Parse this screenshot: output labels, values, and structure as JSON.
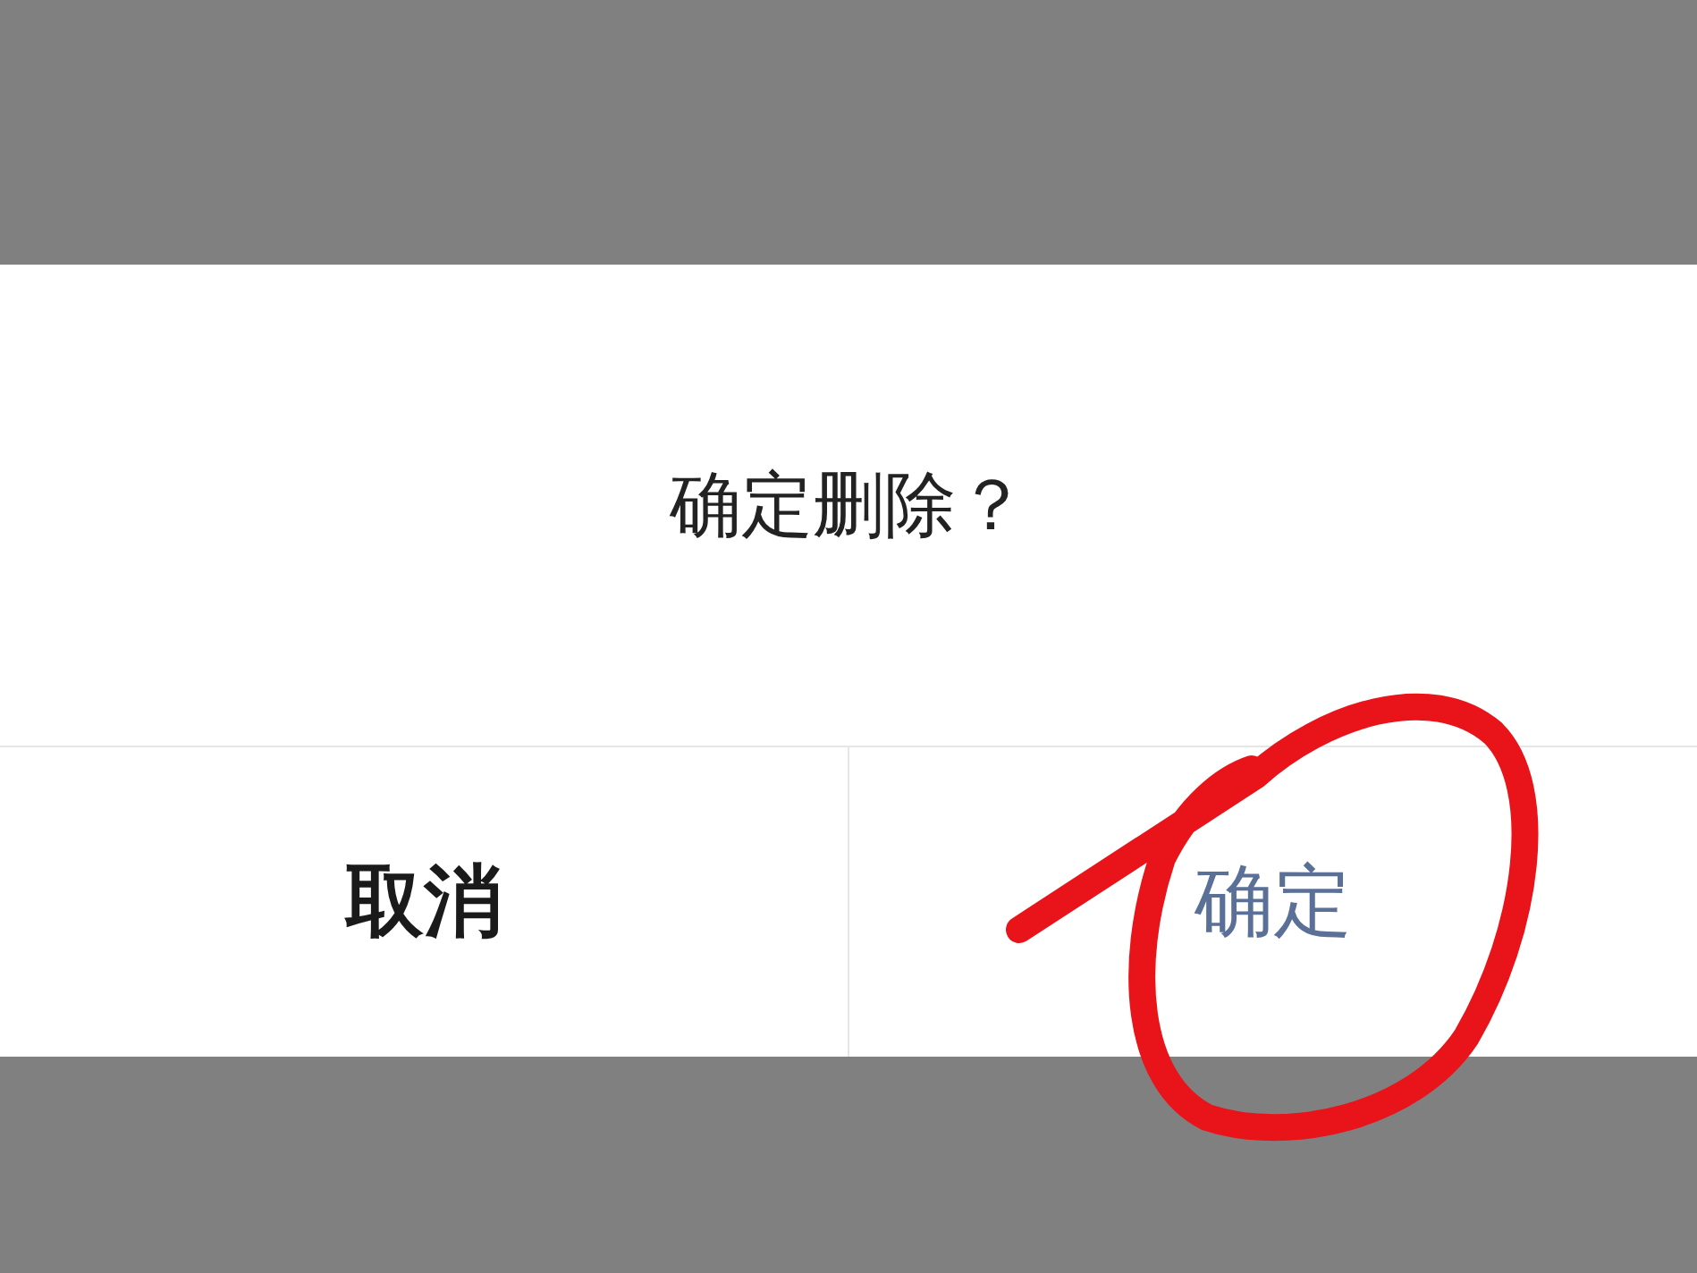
{
  "dialog": {
    "message": "确定删除？",
    "buttons": [
      {
        "label": "取消",
        "kind": "cancel"
      },
      {
        "label": "确定",
        "kind": "confirm"
      }
    ]
  }
}
